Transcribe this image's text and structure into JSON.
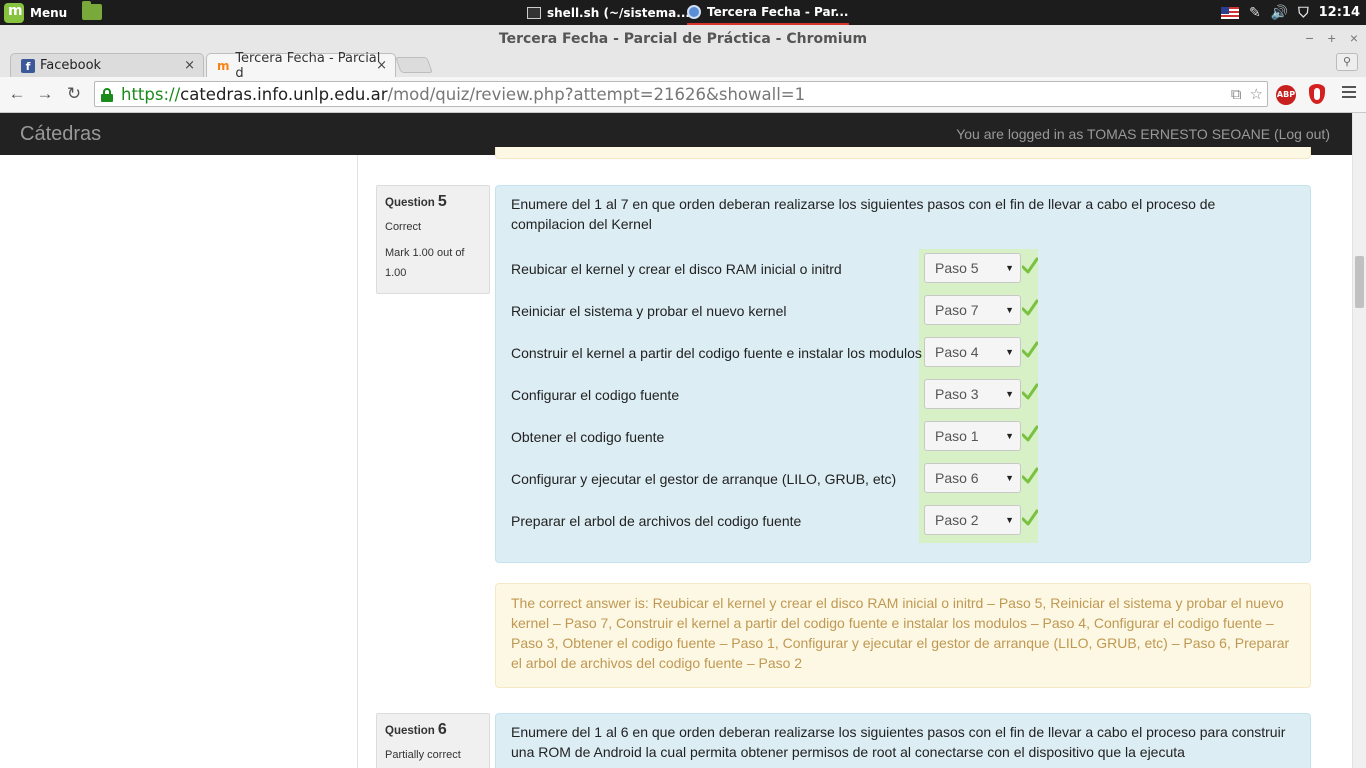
{
  "taskbar": {
    "menu_label": "Menu",
    "tasks": [
      {
        "label": "shell.sh (~/sistema..."
      },
      {
        "label": "Tercera Fecha - Par..."
      }
    ],
    "clock": "12:14"
  },
  "window": {
    "title": "Tercera Fecha - Parcial de Práctica - Chromium",
    "controls": {
      "minimize": "−",
      "maximize": "+",
      "close": "×"
    }
  },
  "tabs": [
    {
      "label": "Facebook",
      "close": "×"
    },
    {
      "label": "Tercera Fecha - Parcial d",
      "close": "×"
    }
  ],
  "toolbar": {
    "back": "←",
    "forward": "→",
    "reload": "↻",
    "url_scheme": "https://",
    "url_host": "catedras.info.unlp.edu.ar",
    "url_path": "/mod/quiz/review.php?attempt=21626&showall=1",
    "abp_label": "ABP"
  },
  "site": {
    "brand": "Cátedras",
    "login_text": "You are logged in as TOMAS ERNESTO SEOANE (Log out)"
  },
  "question5": {
    "title": "Question",
    "number": "5",
    "state": "Correct",
    "mark": "Mark 1.00 out of 1.00",
    "text": "Enumere del 1 al 7 en que orden deberan realizarse los siguientes pasos con el fin de llevar a cabo el proceso de compilacion del Kernel",
    "answers": [
      {
        "label": "Reubicar el kernel y crear el disco RAM inicial o initrd",
        "selected": "Paso 5"
      },
      {
        "label": "Reiniciar el sistema y probar el nuevo kernel",
        "selected": "Paso 7"
      },
      {
        "label": "Construir el kernel a partir del codigo fuente e instalar los modulos",
        "selected": "Paso 4"
      },
      {
        "label": "Configurar el codigo fuente",
        "selected": "Paso 3"
      },
      {
        "label": "Obtener el codigo fuente",
        "selected": "Paso 1"
      },
      {
        "label": "Configurar y ejecutar el gestor de arranque (LILO, GRUB, etc)",
        "selected": "Paso 6"
      },
      {
        "label": "Preparar el arbol de archivos del codigo fuente",
        "selected": "Paso 2"
      }
    ],
    "right_answer": "The correct answer is: Reubicar el kernel y crear el disco RAM inicial o initrd – Paso 5, Reiniciar el sistema y probar el nuevo kernel – Paso 7, Construir el kernel a partir del codigo fuente e instalar los modulos – Paso 4, Configurar el codigo fuente – Paso 3, Obtener el codigo fuente – Paso 1, Configurar y ejecutar el gestor de arranque (LILO, GRUB, etc) – Paso 6, Preparar el arbol de archivos del codigo fuente – Paso 2"
  },
  "question6": {
    "title": "Question",
    "number": "6",
    "state": "Partially correct",
    "text": "Enumere del 1 al 6 en que orden deberan realizarse los siguientes pasos con el fin de llevar a cabo el proceso para construir una ROM de Android la cual permita obtener permisos de root al conectarse con el dispositivo que la ejecuta"
  },
  "colors": {
    "navbar_bg": "#222222",
    "question_bg": "#dcedf4",
    "feedback_bg": "#fcf8e3",
    "feedback_text": "#c09853",
    "correct_bg": "#d7f0c5",
    "check_green": "#7ac142",
    "url_green": "#1b8b1b"
  }
}
